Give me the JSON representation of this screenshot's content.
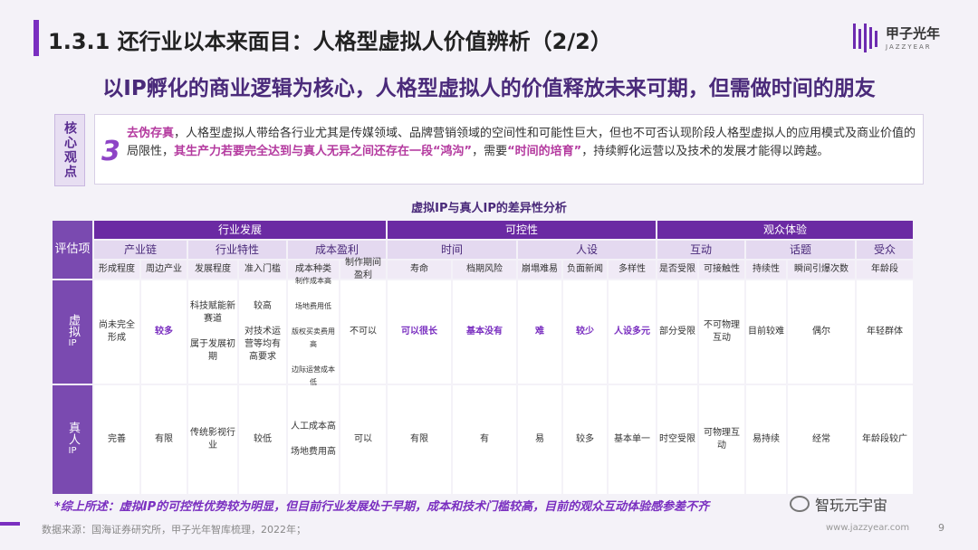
{
  "header": {
    "title": "1.3.1 还行业以本来面目：人格型虚拟人价值辨析（2/2）",
    "logo_cn": "甲子光年",
    "logo_en": "JAZZYEAR",
    "subtitle": "以IP孵化的商业逻辑为核心，人格型虚拟人的价值释放未来可期，但需做时间的朋友"
  },
  "core": {
    "label": "核心观点",
    "number": "3",
    "part1": "去伪存真",
    "part2": "，人格型虚拟人带给各行业尤其是传媒领域、品牌营销领域的空间性和可能性巨大，但也不可否认现阶段人格型虚拟人的应用模式及商业价值的局限性，",
    "part3": "其生产力若要完全达到与真人无异之间还存在一段“鸿沟”",
    "part4": "，需要",
    "part5": "“时间的培育”",
    "part6": "，持续孵化运营以及技术的发展才能得以跨越。"
  },
  "table": {
    "title": "虚拟IP与真人IP的差异性分析",
    "corner": "评估项",
    "groups": [
      "行业发展",
      "可控性",
      "观众体验"
    ],
    "subgroups": [
      "产业链",
      "行业特性",
      "成本盈利",
      "时间",
      "人设",
      "互动",
      "话题",
      "受众"
    ],
    "columns": [
      "形成程度",
      "周边产业",
      "发展程度",
      "准入门槛",
      "成本种类",
      "制作期间盈利",
      "寿命",
      "档期风险",
      "崩塌难易",
      "负面新闻",
      "多样性",
      "是否受限",
      "可接触性",
      "持续性",
      "瞬间引爆次数",
      "年龄段"
    ],
    "row_virtual_label": "虚拟",
    "row_virtual_sub": "IP",
    "row_real_label": "真人",
    "row_real_sub": "IP",
    "virtual": [
      "尚未完全形成",
      "较多",
      "科技赋能新赛道\n\n属于发展初期",
      "较高\n\n对技术运营等均有高要求",
      "制作成本高\n\n场地费用低\n\n版权买卖费用高\n\n边际运营成本低",
      "不可以",
      "可以很长",
      "基本没有",
      "难",
      "较少",
      "人设多元",
      "部分受限",
      "不可物理互动",
      "目前较难",
      "偶尔",
      "年轻群体"
    ],
    "real": [
      "完善",
      "有限",
      "传统影视行业",
      "较低",
      "人工成本高\n\n场地费用高",
      "可以",
      "有限",
      "有",
      "易",
      "较多",
      "基本单一",
      "时空受限",
      "可物理互动",
      "易持续",
      "经常",
      "年龄段较广"
    ]
  },
  "footer": {
    "footnote": "*综上所述：虚拟IP的可控性优势较为明显，但目前行业发展处于早期，成本和技术门槛较高，目前的观众互动体验感参差不齐",
    "source": "数据来源：国海证券研究所，甲子光年智库梳理，2022年；",
    "wechat": "智玩元宇宙",
    "site": "www.jazzyear.com",
    "page": "9"
  }
}
